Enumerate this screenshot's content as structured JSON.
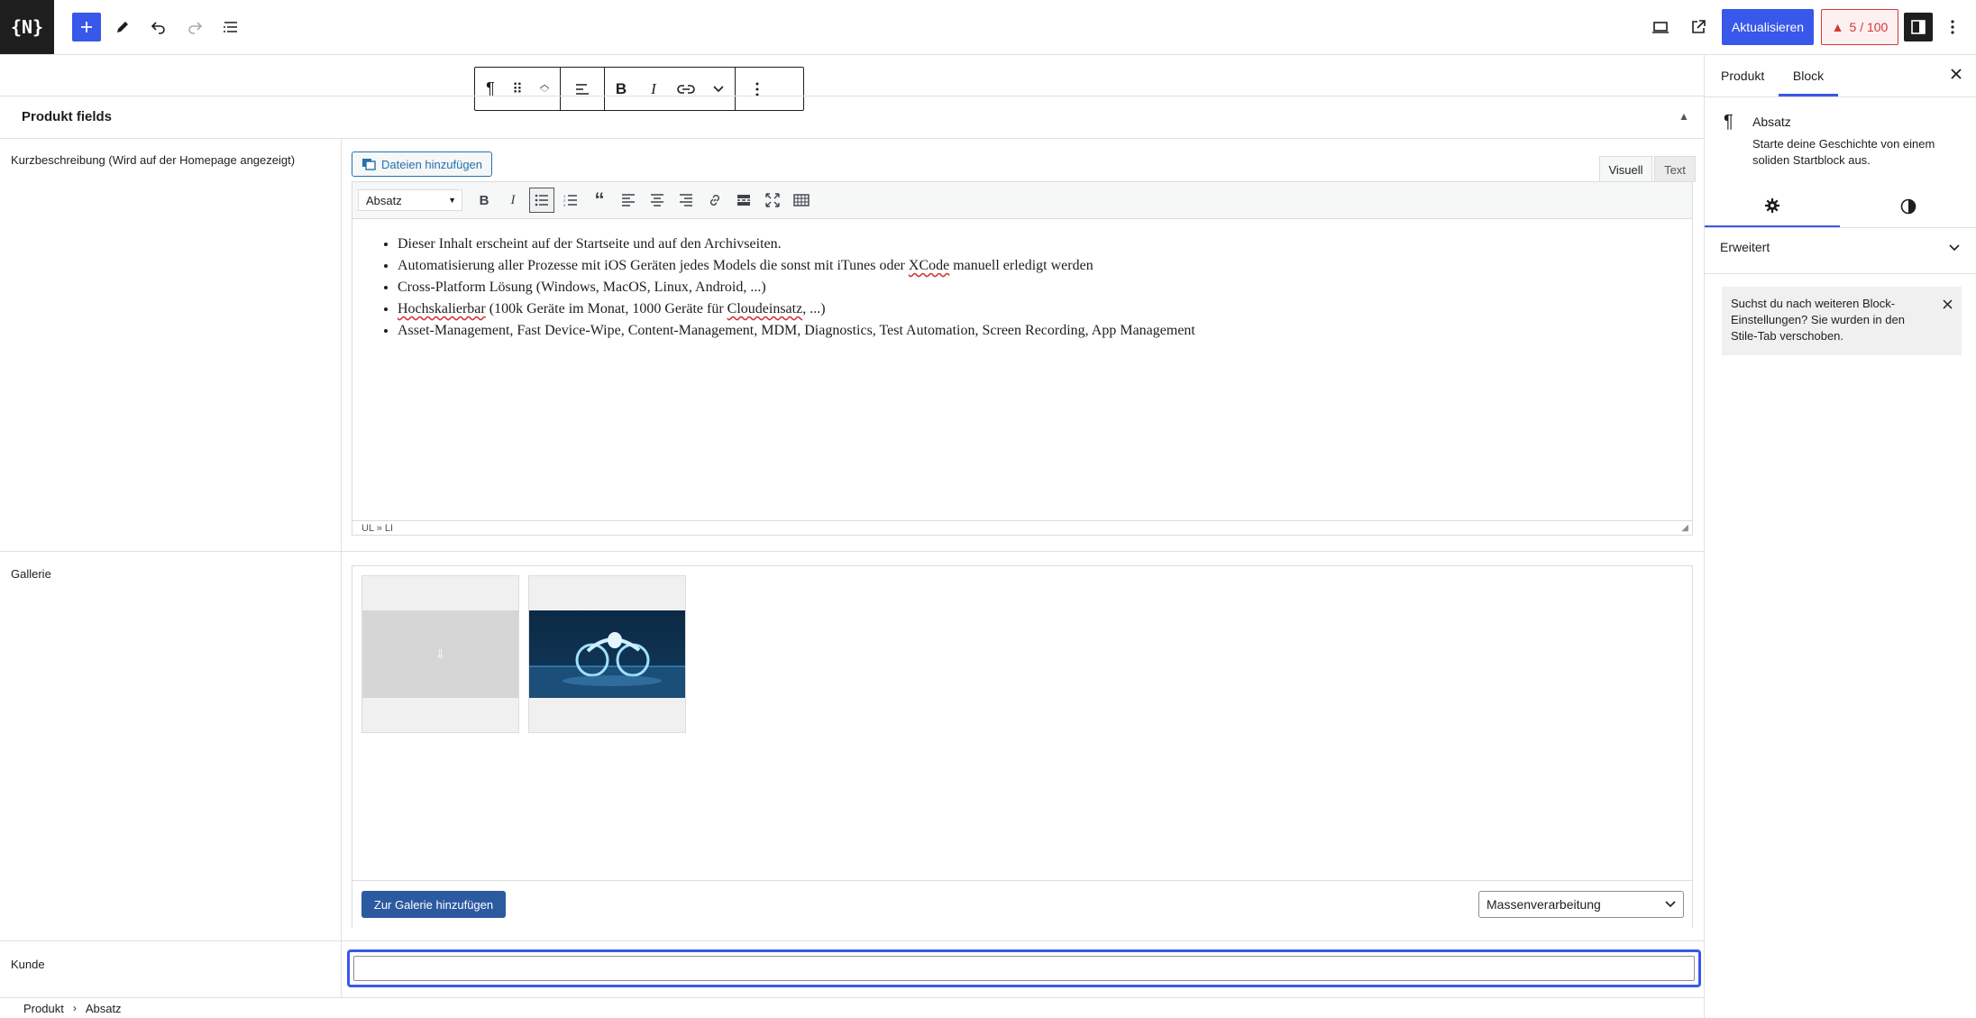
{
  "topbar": {
    "logo_text": "{N}",
    "update_label": "Aktualisieren",
    "score": "5 / 100",
    "accent_color": "#3858e9"
  },
  "panel": {
    "title": "Produkt fields"
  },
  "fields": {
    "short_description": {
      "label": "Kurzbeschreibung (Wird auf der Homepage angezeigt)",
      "media_button": "Dateien hinzufügen",
      "tab_visual": "Visuell",
      "tab_text": "Text",
      "format_value": "Absatz",
      "list_items": [
        "Dieser Inhalt erscheint auf der Startseite und auf den Archivseiten.",
        "Automatisierung aller Prozesse mit iOS Geräten jedes Models die sonst mit iTunes oder XCode manuell erledigt werden",
        "Cross-Platform Lösung (Windows, MacOS, Linux, Android, ...)",
        "Hochskalierbar (100k Geräte im Monat, 1000 Geräte für Cloudeinsatz, ...)",
        "Asset-Management, Fast Device-Wipe, Content-Management, MDM, Diagnostics, Test Automation, Screen Recording, App Management"
      ],
      "status_path": "UL » LI"
    },
    "gallery": {
      "label": "Gallerie",
      "add_button": "Zur Galerie hinzufügen",
      "bulk_select": "Massenverarbeitung"
    },
    "customer": {
      "label": "Kunde",
      "value": ""
    }
  },
  "breadcrumb": {
    "items": [
      "Produkt",
      "Absatz"
    ]
  },
  "sidebar": {
    "tabs": [
      "Produkt",
      "Block"
    ],
    "active_tab": "Block",
    "block_name": "Absatz",
    "block_description": "Starte deine Geschichte von einem soliden Startblock aus.",
    "section_title": "Erweitert",
    "notice": "Suchst du nach weiteren Block-Einstellungen? Sie wurden in den Stile-Tab verschoben."
  }
}
